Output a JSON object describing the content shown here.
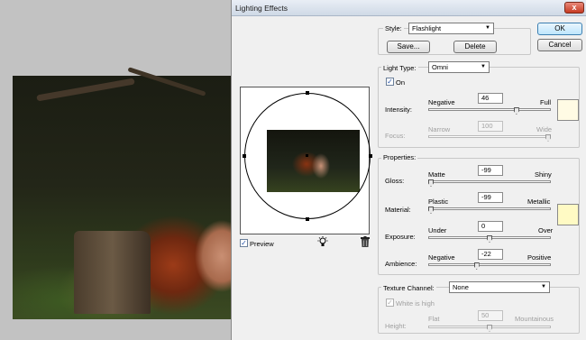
{
  "dialog": {
    "title": "Lighting Effects",
    "close_glyph": "x",
    "ok_label": "OK",
    "cancel_label": "Cancel"
  },
  "style": {
    "label": "Style:",
    "value": "Flashlight",
    "save_label": "Save...",
    "delete_label": "Delete"
  },
  "light_type": {
    "group_label": "Light Type:",
    "value": "Omni",
    "on_label": "On",
    "on_checked": true,
    "intensity": {
      "label": "Intensity:",
      "min_label": "Negative",
      "max_label": "Full",
      "value": "46",
      "fraction": 0.73
    },
    "focus": {
      "label": "Focus:",
      "min_label": "Narrow",
      "max_label": "Wide",
      "value": "100",
      "fraction": 1.0,
      "enabled": false
    },
    "color": "#fffbe4"
  },
  "properties": {
    "group_label": "Properties:",
    "gloss": {
      "label": "Gloss:",
      "min_label": "Matte",
      "max_label": "Shiny",
      "value": "-99",
      "fraction": 0.0
    },
    "material": {
      "label": "Material:",
      "min_label": "Plastic",
      "max_label": "Metallic",
      "value": "-99",
      "fraction": 0.0
    },
    "exposure": {
      "label": "Exposure:",
      "min_label": "Under",
      "max_label": "Over",
      "value": "0",
      "fraction": 0.5
    },
    "ambience": {
      "label": "Ambience:",
      "min_label": "Negative",
      "max_label": "Positive",
      "value": "-22",
      "fraction": 0.39
    },
    "color": "#fffac4"
  },
  "texture": {
    "group_label": "Texture Channel:",
    "value": "None",
    "white_is_high_label": "White is high",
    "white_is_high_checked": true,
    "height": {
      "label": "Height:",
      "min_label": "Flat",
      "max_label": "Mountainous",
      "value": "50",
      "fraction": 0.5
    }
  },
  "preview": {
    "label": "Preview",
    "checked": true,
    "check_glyph": "✓",
    "bulb_icon": "lightbulb-icon",
    "trash_icon": "trash-icon"
  }
}
